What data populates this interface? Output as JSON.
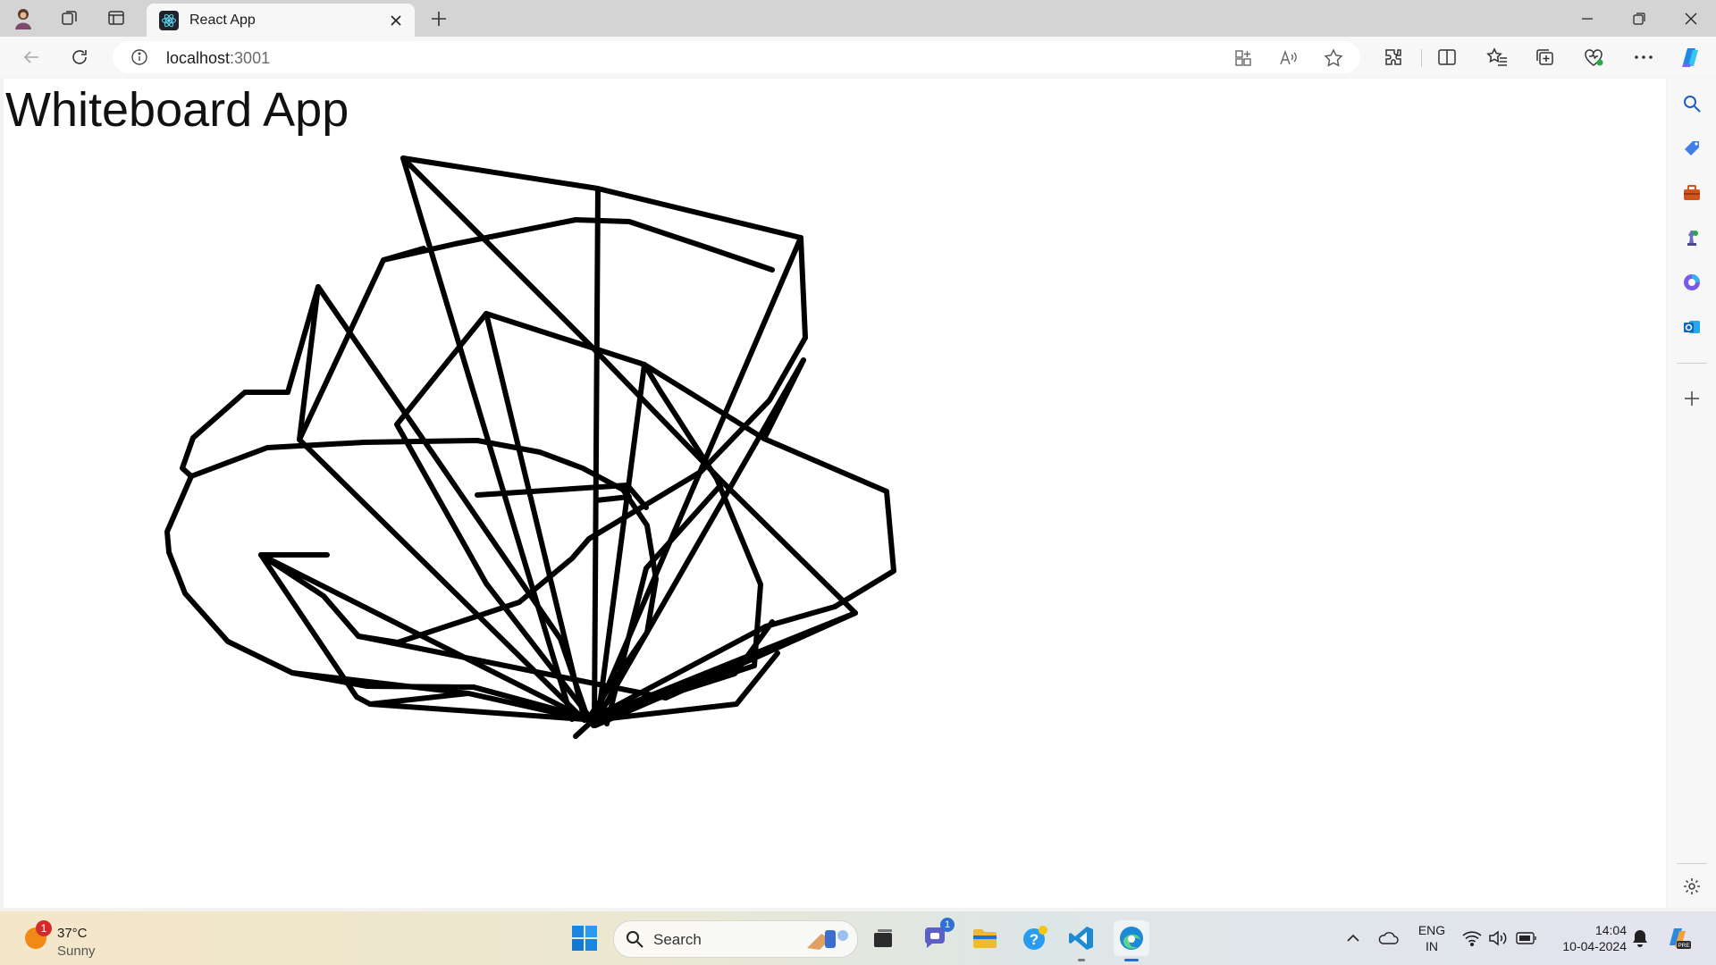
{
  "browser": {
    "tab_title": "React App",
    "url_host": "localhost",
    "url_port": ":3001"
  },
  "page": {
    "title": "Whiteboard App"
  },
  "canvas": {
    "stroke_color": "#000000"
  },
  "taskbar": {
    "weather_temp": "37°C",
    "weather_condition": "Sunny",
    "weather_badge": "1",
    "search_placeholder": "Search",
    "teams_badge": "1",
    "lang_line1": "ENG",
    "lang_line2": "IN",
    "time": "14:04",
    "date": "10-04-2024"
  },
  "colors": {
    "accent": "#0078d4",
    "titlebar": "#d4d4d4"
  }
}
